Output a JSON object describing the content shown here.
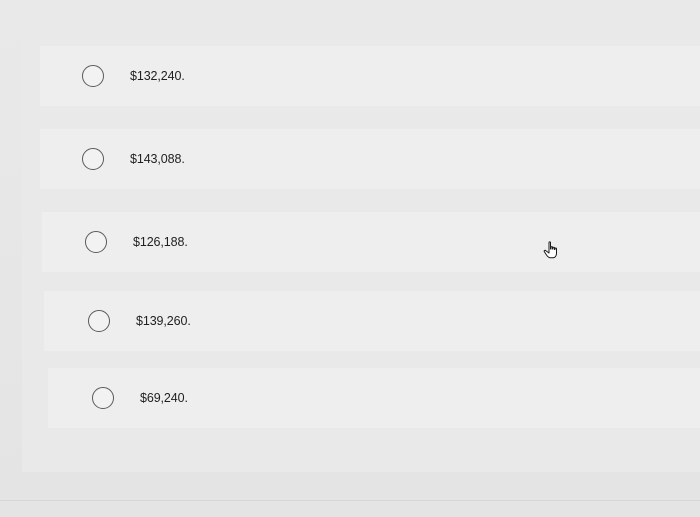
{
  "options": [
    {
      "label": "$132,240."
    },
    {
      "label": "$143,088."
    },
    {
      "label": "$126,188."
    },
    {
      "label": "$139,260."
    },
    {
      "label": "$69,240."
    }
  ],
  "cursor": {
    "icon": "hand-pointer-icon"
  }
}
